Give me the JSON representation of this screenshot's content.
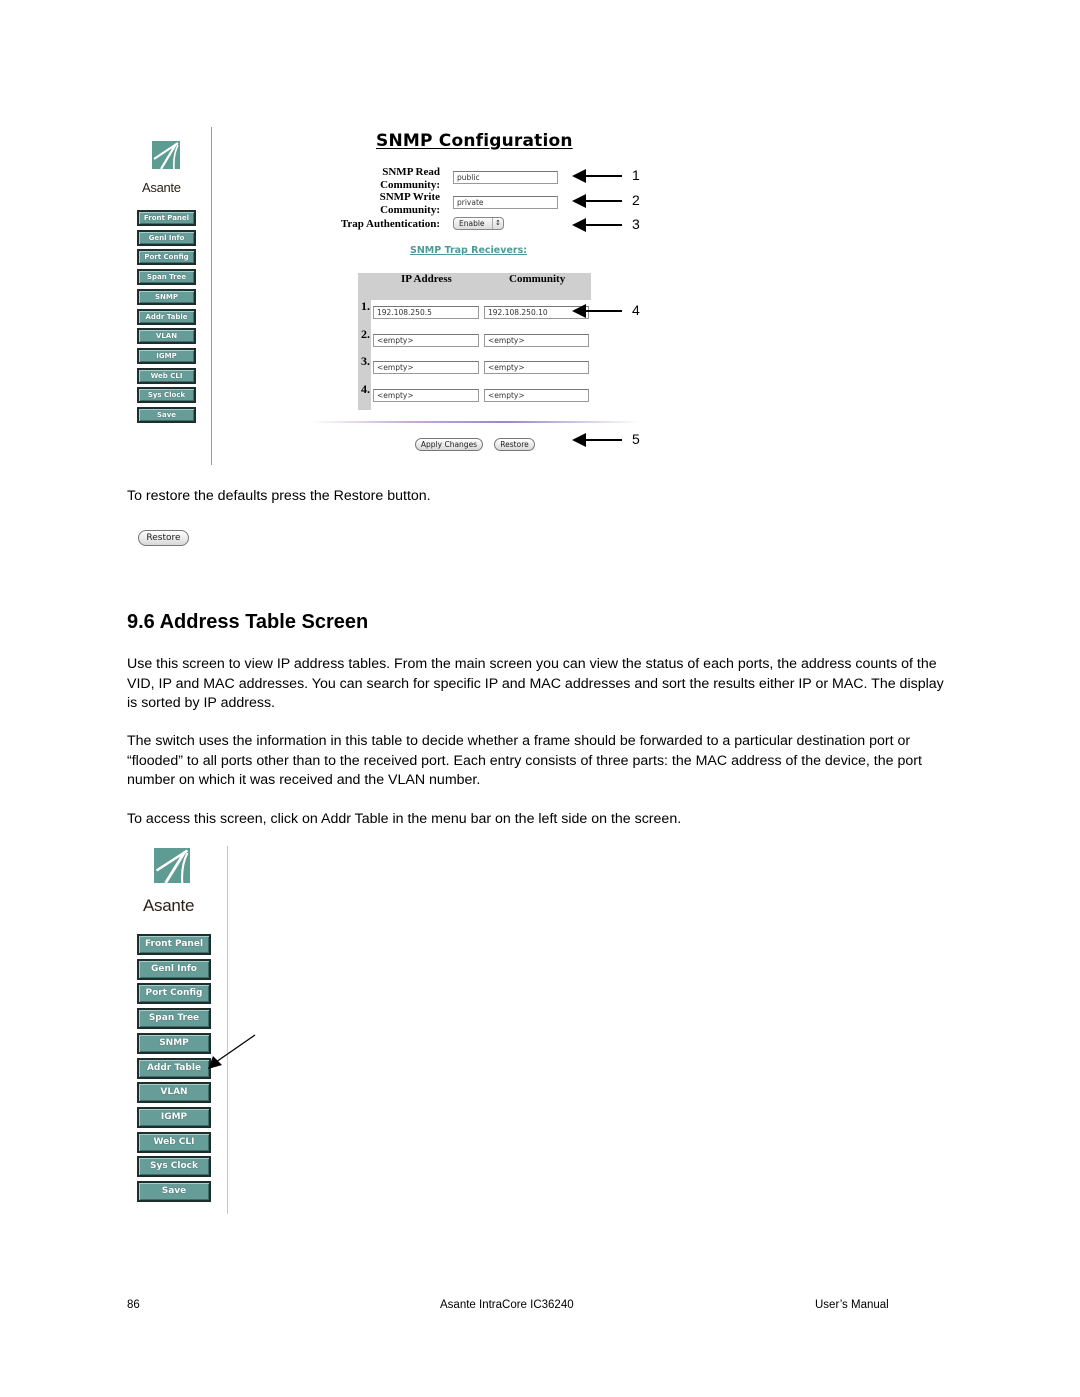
{
  "snmp_screenshot": {
    "brand": "Asante",
    "nav": [
      "Front Panel",
      "Genl Info",
      "Port Config",
      "Span Tree",
      "SNMP",
      "Addr Table",
      "VLAN",
      "IGMP",
      "Web CLI",
      "Sys Clock",
      "Save"
    ],
    "title": "SNMP Configuration",
    "fields": {
      "read_label_1": "SNMP Read",
      "read_label_2": "Community:",
      "read_value": "public",
      "write_label_1": "SNMP Write",
      "write_label_2": "Community:",
      "write_value": "private",
      "trap_auth_label": "Trap Authentication:",
      "trap_auth_value": "Enable"
    },
    "trap_receivers_title": "SNMP Trap Recievers:",
    "table": {
      "headers": [
        "IP Address",
        "Community"
      ],
      "rows": [
        {
          "num": "1.",
          "ip": "192.108.250.5",
          "community": "192.108.250.10"
        },
        {
          "num": "2.",
          "ip": "<empty>",
          "community": "<empty>"
        },
        {
          "num": "3.",
          "ip": "<empty>",
          "community": "<empty>"
        },
        {
          "num": "4.",
          "ip": "<empty>",
          "community": "<empty>"
        }
      ]
    },
    "buttons": {
      "apply": "Apply Changes",
      "restore": "Restore"
    },
    "callouts": [
      "1",
      "2",
      "3",
      "4",
      "5"
    ]
  },
  "restore_text": "To restore the defaults press the Restore button.",
  "restore_button": "Restore",
  "section": {
    "heading": "9.6 Address Table Screen",
    "paragraphs": [
      "Use this screen to view IP address tables. From the main screen you can view the status of each ports, the address counts of the VID, IP and MAC addresses. You can search for specific IP and MAC addresses and sort the results either IP or MAC. The display is sorted by IP address.",
      "The switch uses the information in this table to decide whether a frame should be forwarded to a particular destination port or “flooded” to all ports other than to the received port. Each entry consists of three parts: the MAC address of the device, the port number on which it was received and the VLAN number.",
      "To access this screen, click on Addr Table in the menu bar on the left side on the screen."
    ]
  },
  "addr_screenshot": {
    "brand": "Asante",
    "nav": [
      "Front Panel",
      "Genl Info",
      "Port Config",
      "Span Tree",
      "SNMP",
      "Addr Table",
      "VLAN",
      "IGMP",
      "Web CLI",
      "Sys Clock",
      "Save"
    ],
    "pointer_target": "Addr Table"
  },
  "footer": {
    "page": "86",
    "product": "Asante IntraCore IC36240",
    "manual": "User’s Manual"
  }
}
